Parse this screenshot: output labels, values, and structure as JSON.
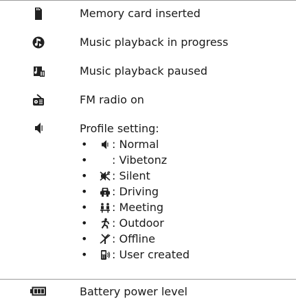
{
  "rows": [
    {
      "icon": "memory-card-icon",
      "text": "Memory card inserted"
    },
    {
      "icon": "music-playing-icon",
      "text": "Music playback in progress"
    },
    {
      "icon": "music-paused-icon",
      "text": "Music playback paused"
    },
    {
      "icon": "fm-radio-icon",
      "text": "FM radio on"
    },
    {
      "icon": "profile-normal-icon",
      "text": "Profile setting:"
    },
    {
      "icon": "battery-icon",
      "text": "Battery power level"
    }
  ],
  "profiles": [
    {
      "icon": "normal-profile-icon",
      "text": ": Normal"
    },
    {
      "icon": "vibetonz-profile-icon",
      "text": ": Vibetonz"
    },
    {
      "icon": "silent-profile-icon",
      "text": ": Silent"
    },
    {
      "icon": "driving-profile-icon",
      "text": ": Driving"
    },
    {
      "icon": "meeting-profile-icon",
      "text": ": Meeting"
    },
    {
      "icon": "outdoor-profile-icon",
      "text": ": Outdoor"
    },
    {
      "icon": "offline-profile-icon",
      "text": ": Offline"
    },
    {
      "icon": "user-created-profile-icon",
      "text": ": User created"
    }
  ],
  "bullet": "•",
  "colors": {
    "rule": "#9a9a9a",
    "text": "#1a1a1a",
    "icon": "#222222"
  }
}
